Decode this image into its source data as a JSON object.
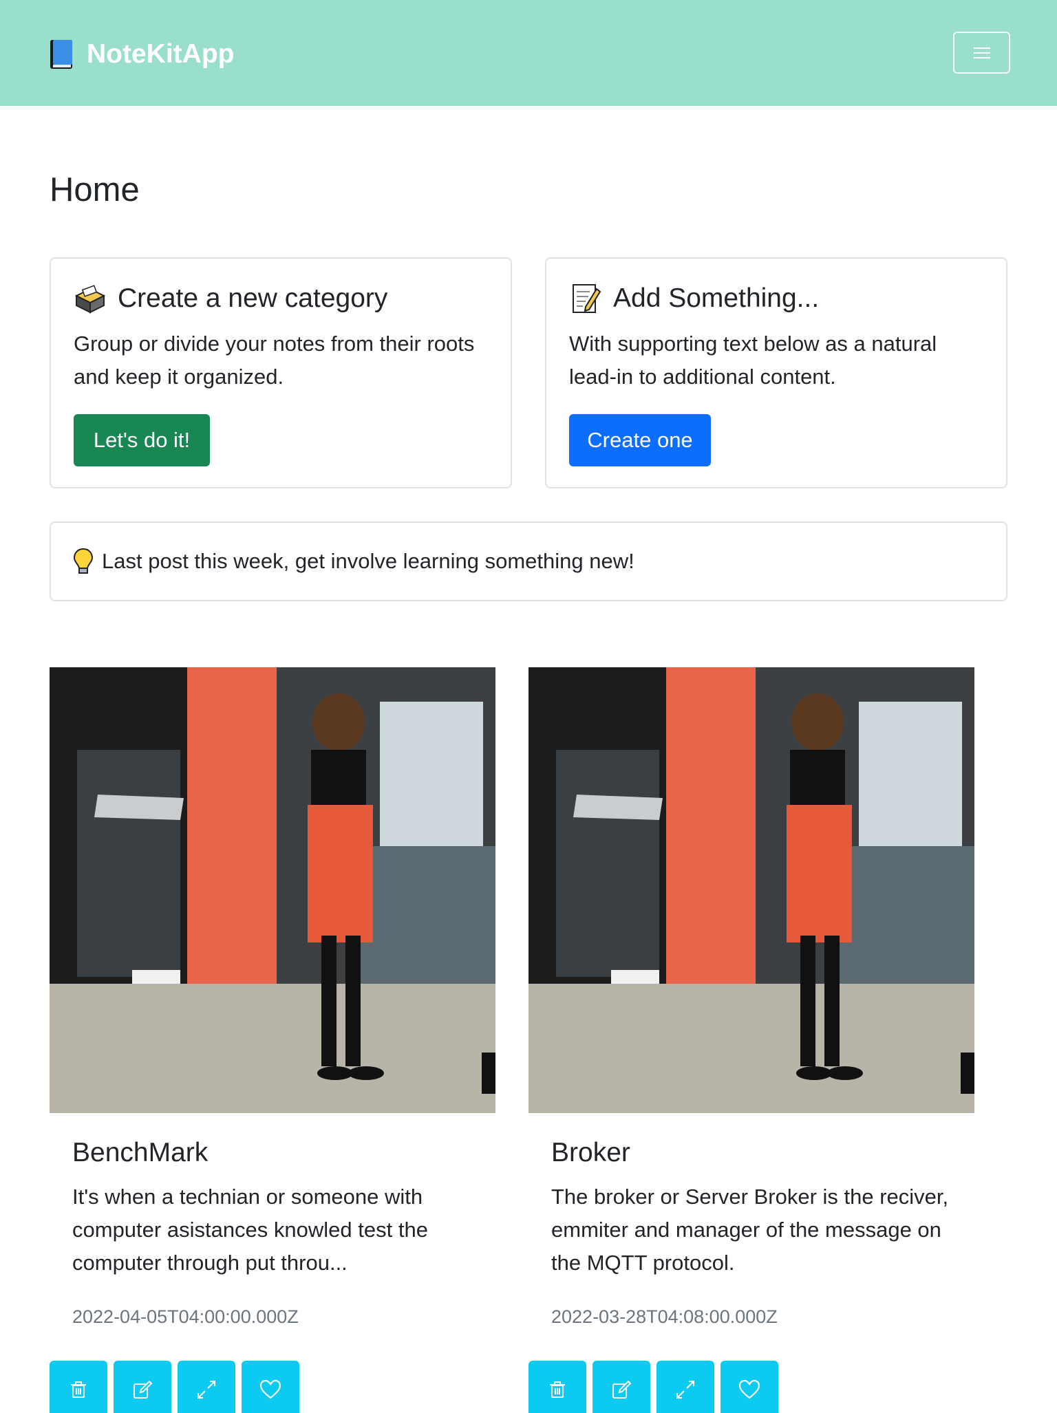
{
  "navbar": {
    "brand": "NoteKitApp",
    "brand_icon": "blue-book-icon",
    "toggler_icon": "hamburger-menu-icon",
    "background": "#99dfcb"
  },
  "page": {
    "title": "Home"
  },
  "cards": [
    {
      "icon": "card-file-box-icon",
      "title": "Create a new category",
      "text": "Group or divide your notes from their roots and keep it organized.",
      "button": "Let's do it!",
      "button_color": "#198754"
    },
    {
      "icon": "memo-icon",
      "title": "Add Something...",
      "text": "With supporting text below as a natural lead-in to additional content.",
      "button": "Create one",
      "button_color": "#0d6efd"
    }
  ],
  "alert": {
    "icon": "lightbulb-icon",
    "text": "Last post this week, get involve learning something new!"
  },
  "posts": [
    {
      "title": "BenchMark",
      "text": "It's when a technian or someone with computer asistances knowled test the computer through put throu...",
      "date": "2022-04-05T04:00:00.000Z",
      "image": "photo-woman-red-dress-phone"
    },
    {
      "title": "Broker",
      "text": "The broker or Server Broker is the reciver, emmiter and manager of the message on the MQTT protocol.",
      "date": "2022-03-28T04:08:00.000Z",
      "image": "photo-woman-red-dress-phone"
    }
  ],
  "post_actions": [
    "trash-icon",
    "edit-icon",
    "expand-icon",
    "heart-icon"
  ],
  "action_color": "#0dcaf0"
}
